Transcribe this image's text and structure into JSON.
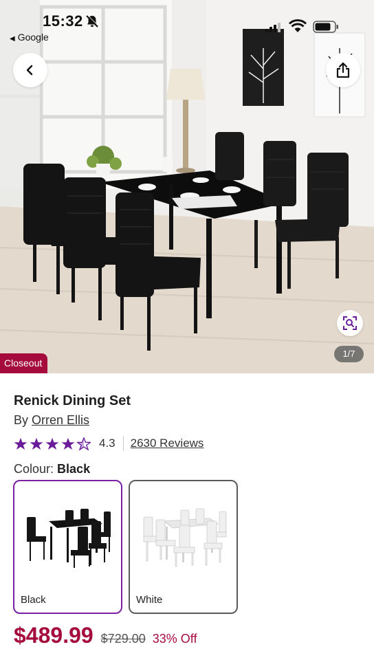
{
  "status_bar": {
    "time": "15:32",
    "back_app": "Google"
  },
  "gallery": {
    "badge": "Closeout",
    "counter": "1/7"
  },
  "product": {
    "title": "Renick Dining Set",
    "brand_prefix": "By",
    "brand": "Orren Ellis",
    "rating": "4.3",
    "rating_value": 4.3,
    "rating_max": 5,
    "reviews": "2630 Reviews"
  },
  "colour": {
    "label": "Colour:",
    "selected": "Black",
    "options": [
      {
        "label": "Black",
        "selected": true
      },
      {
        "label": "White",
        "selected": false
      }
    ]
  },
  "pricing": {
    "price": "$489.99",
    "original": "$729.00",
    "discount": "33% Off"
  },
  "colors": {
    "accent": "#a50b3d",
    "selection": "#7b1fa2",
    "stars": "#6a1b9a"
  },
  "icons": [
    "bell-off-icon",
    "signal-icon",
    "wifi-icon",
    "battery-icon",
    "back-arrow-icon",
    "share-icon",
    "zoom-icon",
    "star-icon",
    "half-star-icon"
  ]
}
